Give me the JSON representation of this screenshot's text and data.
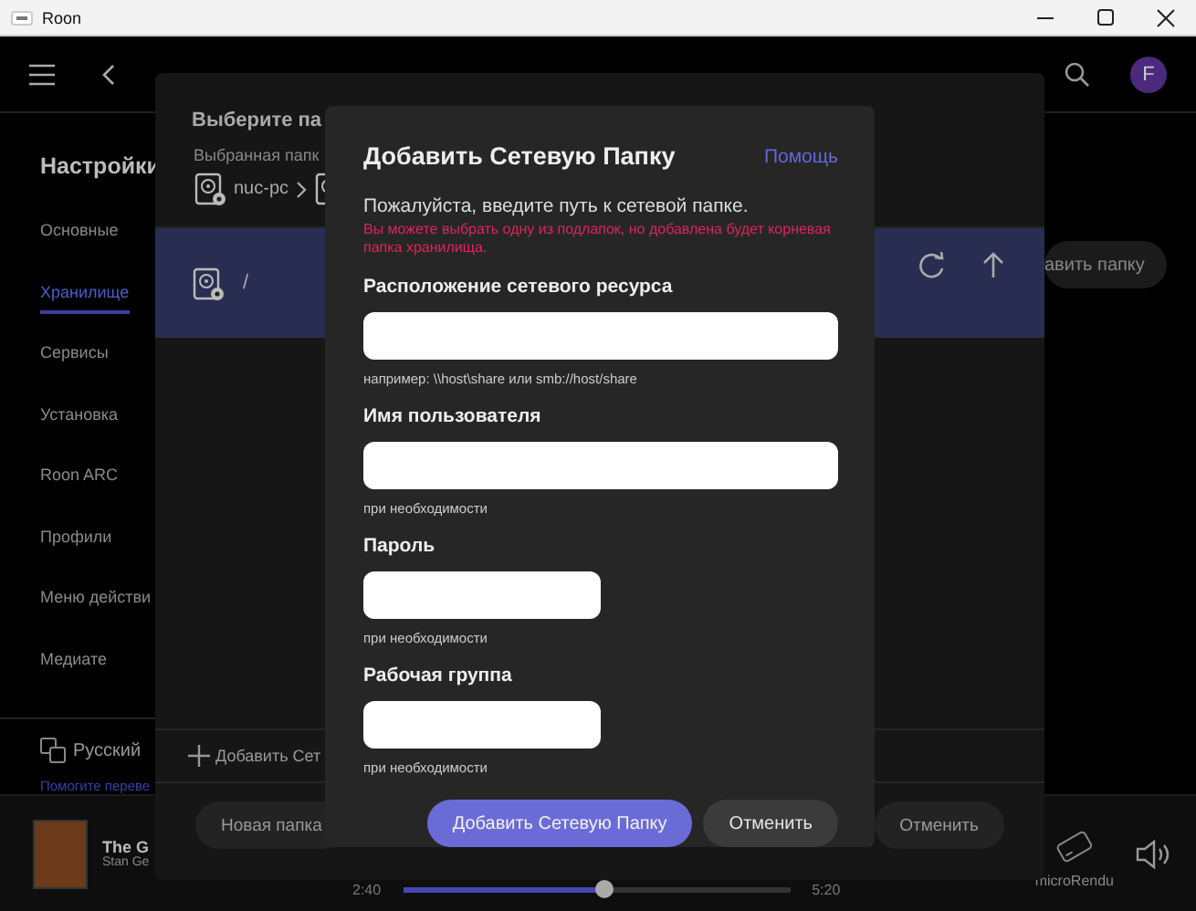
{
  "window": {
    "title": "Roon"
  },
  "header": {
    "avatar": "F"
  },
  "sidebar": {
    "title": "Настройки",
    "items": [
      {
        "label": "Основные",
        "selected": false
      },
      {
        "label": "Хранилище",
        "selected": true
      },
      {
        "label": "Сервисы",
        "selected": false
      },
      {
        "label": "Установка",
        "selected": false
      },
      {
        "label": "Roon ARC",
        "selected": false
      },
      {
        "label": "Профили",
        "selected": false
      },
      {
        "label": "Меню действи",
        "selected": false
      },
      {
        "label": "Медиате",
        "selected": false
      }
    ],
    "language": "Русский",
    "help_link": "Помогите переве"
  },
  "storage": {
    "add_button": "авить папку"
  },
  "folder_dialog": {
    "title": "Выберите па",
    "selected_label": "Выбранная папк",
    "breadcrumb": [
      "nuc-pc"
    ],
    "folders": [
      {
        "name": "/",
        "selected": true
      }
    ],
    "add_network": "Добавить Сет",
    "buttons": [
      {
        "label": "Новая папка"
      },
      {
        "label": "Отменить"
      }
    ]
  },
  "network_dialog": {
    "title": "Добавить Сетевую Папку",
    "help": "Помощь",
    "intro": "Пожалуйста, введите путь к сетевой папке.",
    "warning": "Вы можете выбрать одну из подлапок, но добавлена будет корневая папка хранилища.",
    "fields": [
      {
        "kind": "wide",
        "label": "Расположение сетевого ресурса",
        "hint": "например: \\\\host\\share или smb://host/share"
      },
      {
        "kind": "wide",
        "label": "Имя пользователя",
        "hint": "при необходимости"
      },
      {
        "kind": "short",
        "label": "Пароль",
        "hint": "при необходимости"
      },
      {
        "kind": "short",
        "label": "Рабочая группа",
        "hint": "при необходимости"
      }
    ],
    "buttons": [
      {
        "label": "Добавить Сетевую Папку",
        "kind": "primary"
      },
      {
        "label": "Отменить",
        "kind": "secondary"
      }
    ]
  },
  "player": {
    "title": "The G",
    "artist": "Stan Ge",
    "elapsed": "2:40",
    "total": "5:20",
    "level": 0.52,
    "zone": "microRendu"
  }
}
